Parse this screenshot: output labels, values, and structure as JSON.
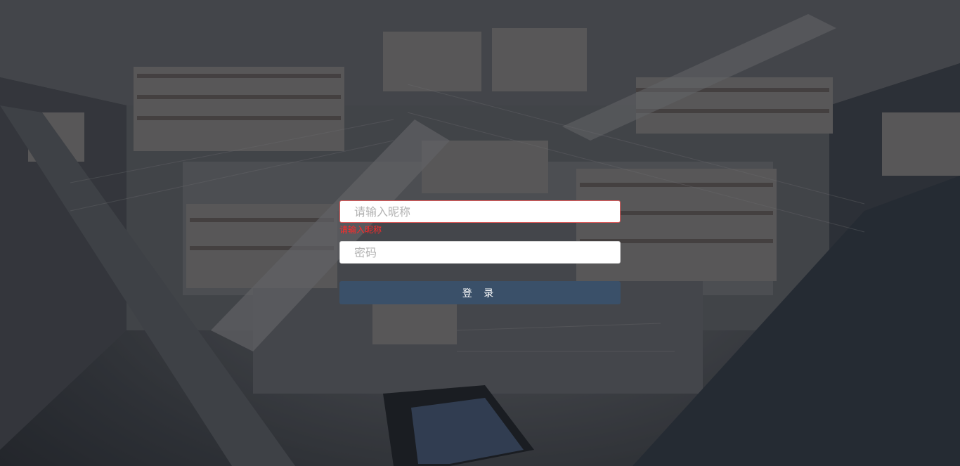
{
  "login": {
    "nickname": {
      "placeholder": "请输入昵称",
      "value": "",
      "error": "请输入昵称"
    },
    "password": {
      "placeholder": "密码",
      "value": ""
    },
    "submit_label": "登 录"
  },
  "colors": {
    "button_bg": "#3a5069",
    "error": "#ff2a2a",
    "input_bg": "#ffffff"
  }
}
